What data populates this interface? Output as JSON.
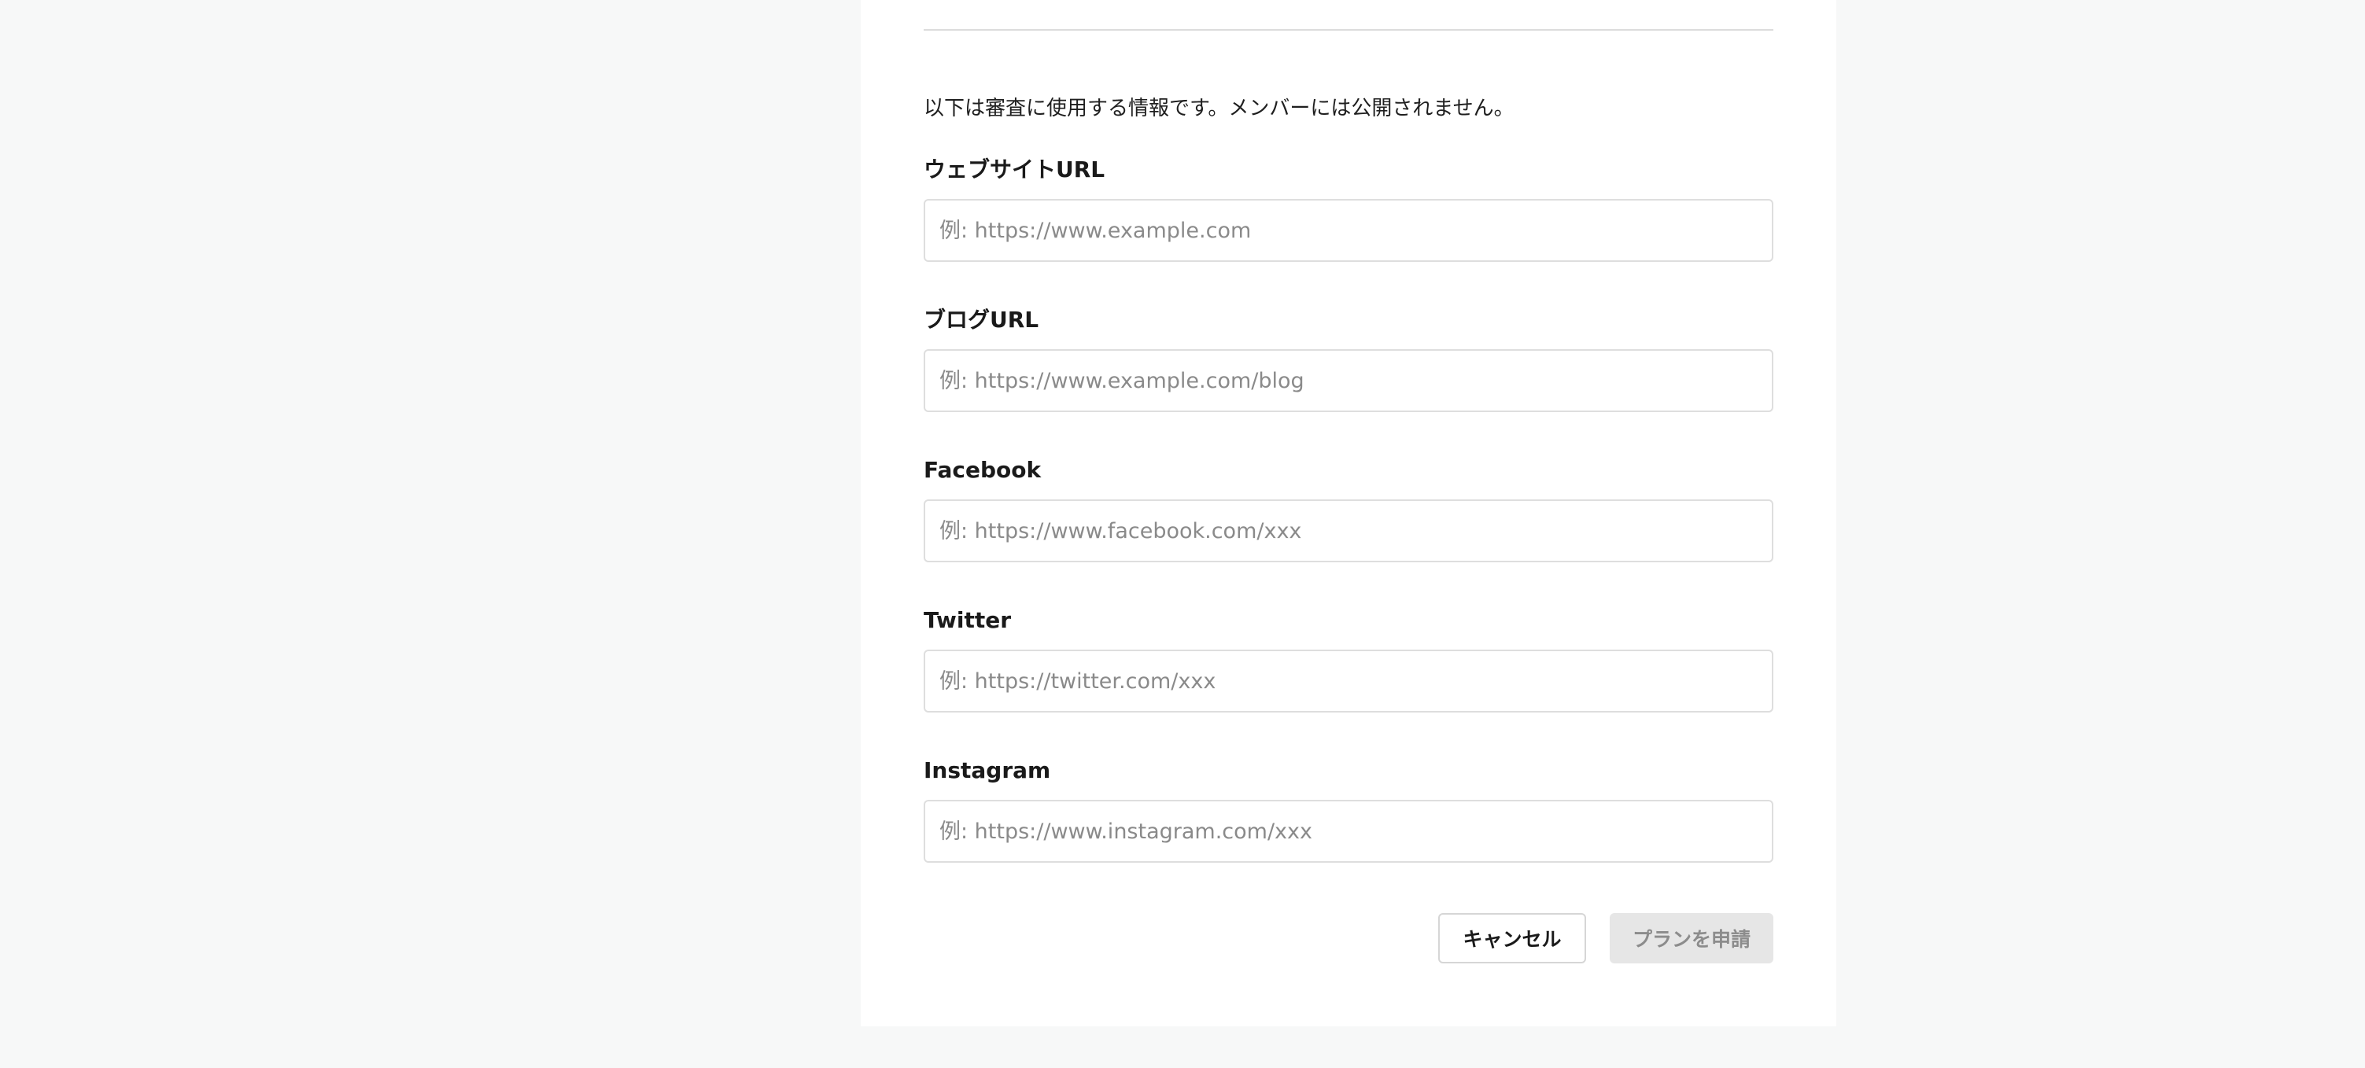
{
  "notice": "以下は審査に使用する情報です。メンバーには公開されません。",
  "fields": [
    {
      "label": "ウェブサイトURL",
      "placeholder": "例: https://www.example.com",
      "value": ""
    },
    {
      "label": "ブログURL",
      "placeholder": "例: https://www.example.com/blog",
      "value": ""
    },
    {
      "label": "Facebook",
      "placeholder": "例: https://www.facebook.com/xxx",
      "value": ""
    },
    {
      "label": "Twitter",
      "placeholder": "例: https://twitter.com/xxx",
      "value": ""
    },
    {
      "label": "Instagram",
      "placeholder": "例: https://www.instagram.com/xxx",
      "value": ""
    }
  ],
  "buttons": {
    "cancel": "キャンセル",
    "submit": "プランを申請"
  },
  "colors": {
    "page_background": "#f7f8f8",
    "panel_background": "#ffffff",
    "input_border": "#dedede",
    "submit_disabled_bg": "#e6e6e6",
    "submit_disabled_text": "#8c8c8c"
  }
}
